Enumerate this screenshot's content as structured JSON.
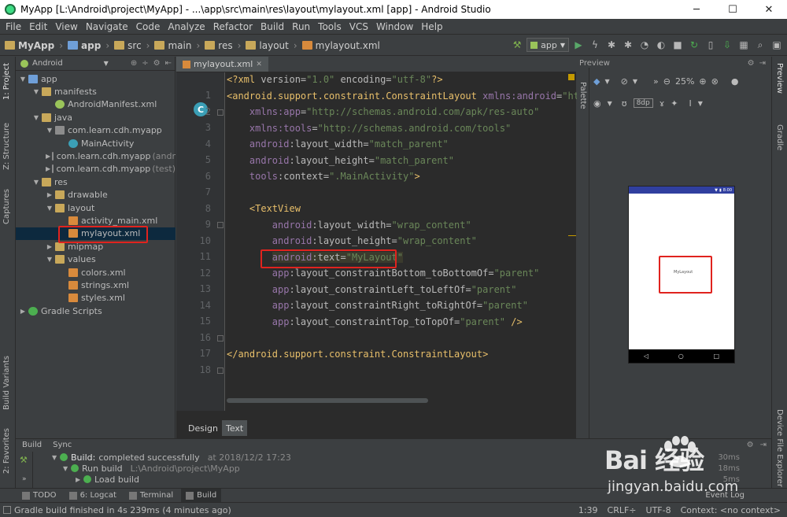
{
  "window": {
    "title": "MyApp [L:\\Android\\project\\MyApp] - ...\\app\\src\\main\\res\\layout\\mylayout.xml [app] - Android Studio",
    "minimize": "─",
    "maximize": "☐",
    "close": "✕"
  },
  "menu": [
    "File",
    "Edit",
    "View",
    "Navigate",
    "Code",
    "Analyze",
    "Refactor",
    "Build",
    "Run",
    "Tools",
    "VCS",
    "Window",
    "Help"
  ],
  "breadcrumb": [
    "MyApp",
    "app",
    "src",
    "main",
    "res",
    "layout",
    "mylayout.xml"
  ],
  "toolbar": {
    "run_config": "app"
  },
  "left_tabs": [
    "1: Project",
    "Z: Structure",
    "Captures",
    "Build Variants",
    "2: Favorites"
  ],
  "right_tabs": [
    "Preview",
    "Gradle",
    "Device File Explorer"
  ],
  "project": {
    "view_mode": "Android",
    "tree": [
      {
        "label": "app",
        "muted": "",
        "icon": "module"
      },
      {
        "label": "manifests",
        "muted": "",
        "icon": "folder"
      },
      {
        "label": "AndroidManifest.xml",
        "muted": "",
        "icon": "manifest"
      },
      {
        "label": "java",
        "muted": "",
        "icon": "folder"
      },
      {
        "label": "com.learn.cdh.myapp",
        "muted": "",
        "icon": "pkg"
      },
      {
        "label": "MainActivity",
        "muted": "",
        "icon": "class"
      },
      {
        "label": "com.learn.cdh.myapp",
        "muted": "(andr",
        "icon": "pkg"
      },
      {
        "label": "com.learn.cdh.myapp",
        "muted": "(test)",
        "icon": "pkg"
      },
      {
        "label": "res",
        "muted": "",
        "icon": "folder"
      },
      {
        "label": "drawable",
        "muted": "",
        "icon": "folder"
      },
      {
        "label": "layout",
        "muted": "",
        "icon": "folder"
      },
      {
        "label": "activity_main.xml",
        "muted": "",
        "icon": "xml"
      },
      {
        "label": "mylayout.xml",
        "muted": "",
        "icon": "xml"
      },
      {
        "label": "mipmap",
        "muted": "",
        "icon": "folder"
      },
      {
        "label": "values",
        "muted": "",
        "icon": "folder"
      },
      {
        "label": "colors.xml",
        "muted": "",
        "icon": "xml"
      },
      {
        "label": "strings.xml",
        "muted": "",
        "icon": "xml"
      },
      {
        "label": "styles.xml",
        "muted": "",
        "icon": "xml"
      },
      {
        "label": "Gradle Scripts",
        "muted": "",
        "icon": "gradle"
      }
    ]
  },
  "editor": {
    "tab": "mylayout.xml",
    "gutter_marker": "C",
    "line_numbers": [
      "1",
      "2",
      "3",
      "4",
      "5",
      "6",
      "7",
      "8",
      "9",
      "10",
      "11",
      "12",
      "13",
      "14",
      "15",
      "16",
      "17",
      "18"
    ],
    "lines": [
      [
        [
          "tg",
          "<?xml "
        ],
        [
          "at",
          "version="
        ],
        [
          "av",
          "\"1.0\""
        ],
        [
          "at",
          " encoding="
        ],
        [
          "av",
          "\"utf-8\""
        ],
        [
          "tg",
          "?>"
        ]
      ],
      [
        [
          "tg",
          "<android.support.constraint.ConstraintLayout "
        ],
        [
          "an",
          "xmlns:android"
        ],
        [
          "at",
          "="
        ],
        [
          "av",
          "\"http"
        ]
      ],
      [
        [
          "ap",
          "    "
        ],
        [
          "an",
          "xmlns:app"
        ],
        [
          "at",
          "="
        ],
        [
          "av",
          "\"http://schemas.android.com/apk/res-auto\""
        ]
      ],
      [
        [
          "ap",
          "    "
        ],
        [
          "an",
          "xmlns:tools"
        ],
        [
          "at",
          "="
        ],
        [
          "av",
          "\"http://schemas.android.com/tools\""
        ]
      ],
      [
        [
          "ap",
          "    "
        ],
        [
          "an",
          "android"
        ],
        [
          "at",
          ":layout_width="
        ],
        [
          "av",
          "\"match_parent\""
        ]
      ],
      [
        [
          "ap",
          "    "
        ],
        [
          "an",
          "android"
        ],
        [
          "at",
          ":layout_height="
        ],
        [
          "av",
          "\"match_parent\""
        ]
      ],
      [
        [
          "ap",
          "    "
        ],
        [
          "an",
          "tools"
        ],
        [
          "at",
          ":context="
        ],
        [
          "av",
          "\".MainActivity\""
        ],
        [
          "tg",
          ">"
        ]
      ],
      [],
      [
        [
          "ap",
          "    "
        ],
        [
          "tg",
          "<TextView"
        ]
      ],
      [
        [
          "ap",
          "        "
        ],
        [
          "an",
          "android"
        ],
        [
          "at",
          ":layout_width="
        ],
        [
          "av",
          "\"wrap_content\""
        ]
      ],
      [
        [
          "ap",
          "        "
        ],
        [
          "an",
          "android"
        ],
        [
          "at",
          ":layout_height="
        ],
        [
          "av",
          "\"wrap_content\""
        ]
      ],
      [
        [
          "ap",
          "        "
        ],
        [
          "an",
          "android"
        ],
        [
          "at",
          ":text="
        ],
        [
          "av",
          "\"MyLayout\""
        ]
      ],
      [
        [
          "ap",
          "        "
        ],
        [
          "an",
          "app"
        ],
        [
          "at",
          ":layout_constraintBottom_toBottomOf="
        ],
        [
          "av",
          "\"parent\""
        ]
      ],
      [
        [
          "ap",
          "        "
        ],
        [
          "an",
          "app"
        ],
        [
          "at",
          ":layout_constraintLeft_toLeftOf="
        ],
        [
          "av",
          "\"parent\""
        ]
      ],
      [
        [
          "ap",
          "        "
        ],
        [
          "an",
          "app"
        ],
        [
          "at",
          ":layout_constraintRight_toRightOf="
        ],
        [
          "av",
          "\"parent\""
        ]
      ],
      [
        [
          "ap",
          "        "
        ],
        [
          "an",
          "app"
        ],
        [
          "at",
          ":layout_constraintTop_toTopOf="
        ],
        [
          "av",
          "\"parent\""
        ],
        [
          "tg",
          " />"
        ]
      ],
      [],
      [
        [
          "tg",
          "</android.support.constraint.ConstraintLayout>"
        ]
      ]
    ],
    "bottom_tabs": [
      "Design",
      "Text"
    ]
  },
  "preview": {
    "header": "Preview",
    "palette_tab": "Palette",
    "zoom": "25%",
    "dp_label": "8dp",
    "status_time": "8:00",
    "screen_text": "MyLayout",
    "nav_buttons": [
      "◁",
      "○",
      "□"
    ]
  },
  "build": {
    "tabs": [
      "Build",
      "Sync"
    ],
    "rows": [
      {
        "label": "Build:",
        "detail": "completed successfully",
        "muted": "at 2018/12/2 17:23",
        "dur": "30ms"
      },
      {
        "label": "Run build",
        "detail": "",
        "muted": "L:\\Android\\project\\MyApp",
        "dur": "18ms"
      },
      {
        "label": "Load build",
        "detail": "",
        "muted": "",
        "dur": "5ms"
      }
    ]
  },
  "tool_tabs": [
    {
      "label": "TODO",
      "name": "todo"
    },
    {
      "label": "6: Logcat",
      "name": "logcat"
    },
    {
      "label": "Terminal",
      "name": "terminal"
    },
    {
      "label": "Build",
      "name": "build"
    }
  ],
  "event_log": "Event Log",
  "status": {
    "message": "Gradle build finished in 4s 239ms (4 minutes ago)",
    "position": "1:39",
    "line_sep": "CRLF÷",
    "encoding": "UTF-8",
    "context": "Context: <no context>"
  },
  "watermark": {
    "logo": "Bai  经验",
    "url": "jingyan.baidu.com"
  },
  "colors": {
    "background": "#2b2b2b",
    "panel": "#3c3f41",
    "highlight_box": "#e0231e",
    "selection": "#0d293e"
  }
}
